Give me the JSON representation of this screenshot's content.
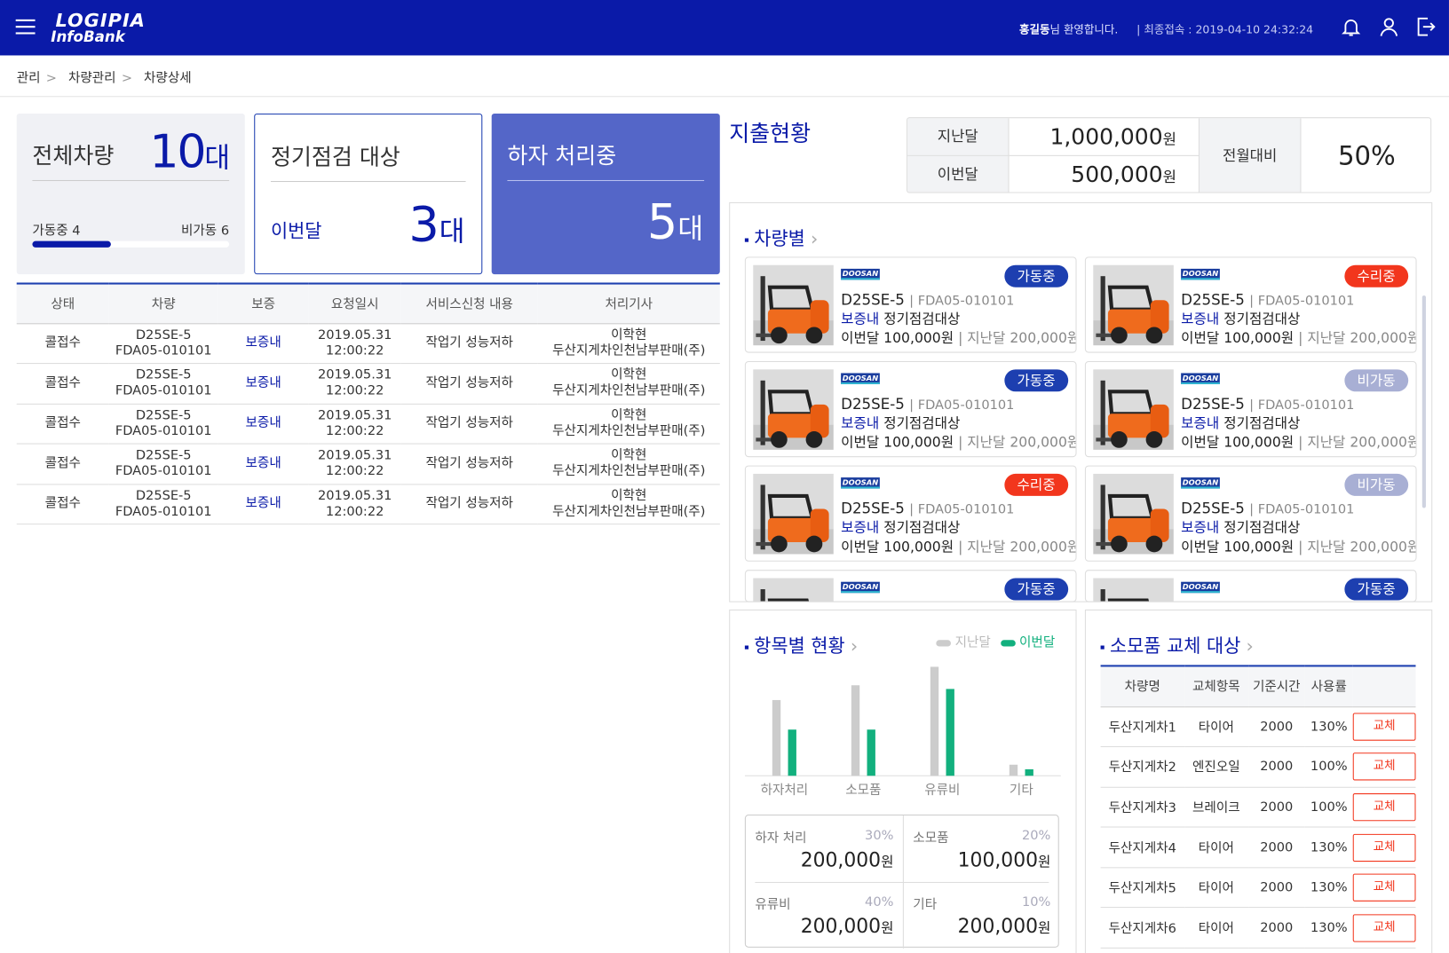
{
  "header": {
    "logo_top": "LOGIPIA",
    "logo_bottom": "InfoBank",
    "user_name": "홍길동",
    "welcome_suffix": "님 환영합니다.",
    "last_login": "|   최종접속 : 2019-04-10 24:32:24"
  },
  "breadcrumb": [
    "관리",
    "차량관리",
    "차량상세"
  ],
  "summary": {
    "total": {
      "title": "전체차량",
      "count": "10",
      "unit": "대",
      "active_label": "가동중 4",
      "inactive_label": "비가동 6",
      "active_ratio": 0.4
    },
    "inspect": {
      "title": "정기점검 대상",
      "period": "이번달",
      "count": "3",
      "unit": "대"
    },
    "defect": {
      "title": "하자 처리중",
      "count": "5",
      "unit": "대"
    }
  },
  "requests": {
    "columns": [
      "상태",
      "차량",
      "보증",
      "요청일시",
      "서비스신청 내용",
      "처리기사"
    ],
    "rows": [
      {
        "status": "콜접수",
        "model": "D25SE-5",
        "serial": "FDA05-010101",
        "warranty": "보증내",
        "date": "2019.05.31",
        "time": "12:00:22",
        "content": "작업기 성능저하",
        "tech": "이학현",
        "dealer": "두산지게차인천남부판매(주)"
      },
      {
        "status": "콜접수",
        "model": "D25SE-5",
        "serial": "FDA05-010101",
        "warranty": "보증내",
        "date": "2019.05.31",
        "time": "12:00:22",
        "content": "작업기 성능저하",
        "tech": "이학현",
        "dealer": "두산지게차인천남부판매(주)"
      },
      {
        "status": "콜접수",
        "model": "D25SE-5",
        "serial": "FDA05-010101",
        "warranty": "보증내",
        "date": "2019.05.31",
        "time": "12:00:22",
        "content": "작업기 성능저하",
        "tech": "이학현",
        "dealer": "두산지게차인천남부판매(주)"
      },
      {
        "status": "콜접수",
        "model": "D25SE-5",
        "serial": "FDA05-010101",
        "warranty": "보증내",
        "date": "2019.05.31",
        "time": "12:00:22",
        "content": "작업기 성능저하",
        "tech": "이학현",
        "dealer": "두산지게차인천남부판매(주)"
      },
      {
        "status": "콜접수",
        "model": "D25SE-5",
        "serial": "FDA05-010101",
        "warranty": "보증내",
        "date": "2019.05.31",
        "time": "12:00:22",
        "content": "작업기 성능저하",
        "tech": "이학현",
        "dealer": "두산지게차인천남부판매(주)"
      }
    ]
  },
  "expense": {
    "title": "지출현황",
    "last_label": "지난달",
    "last_value": "1,000,000",
    "this_label": "이번달",
    "this_value": "500,000",
    "currency": "원",
    "compare_label": "전월대비",
    "compare_value": "50%"
  },
  "vehicles": {
    "title": "차량별",
    "brand": "DOOSAN",
    "cards": [
      {
        "status": "가동중",
        "status_type": "on",
        "model": "D25SE-5",
        "serial": "FDA05-010101",
        "warranty": "보증내",
        "note": "정기점검대상",
        "this_month": "이번달 100,000원",
        "last_month": "지난달 200,000원"
      },
      {
        "status": "수리중",
        "status_type": "fix",
        "model": "D25SE-5",
        "serial": "FDA05-010101",
        "warranty": "보증내",
        "note": "정기점검대상",
        "this_month": "이번달 100,000원",
        "last_month": "지난달 200,000원"
      },
      {
        "status": "가동중",
        "status_type": "on",
        "model": "D25SE-5",
        "serial": "FDA05-010101",
        "warranty": "보증내",
        "note": "정기점검대상",
        "this_month": "이번달 100,000원",
        "last_month": "지난달 200,000원"
      },
      {
        "status": "비가동",
        "status_type": "off",
        "model": "D25SE-5",
        "serial": "FDA05-010101",
        "warranty": "보증내",
        "note": "정기점검대상",
        "this_month": "이번달 100,000원",
        "last_month": "지난달 200,000원"
      },
      {
        "status": "수리중",
        "status_type": "fix",
        "model": "D25SE-5",
        "serial": "FDA05-010101",
        "warranty": "보증내",
        "note": "정기점검대상",
        "this_month": "이번달 100,000원",
        "last_month": "지난달 200,000원"
      },
      {
        "status": "비가동",
        "status_type": "off",
        "model": "D25SE-5",
        "serial": "FDA05-010101",
        "warranty": "보증내",
        "note": "정기점검대상",
        "this_month": "이번달 100,000원",
        "last_month": "지난달 200,000원"
      },
      {
        "status": "가동중",
        "status_type": "on",
        "model": "",
        "serial": "",
        "warranty": "",
        "note": "",
        "this_month": "",
        "last_month": ""
      },
      {
        "status": "가동중",
        "status_type": "on",
        "model": "",
        "serial": "",
        "warranty": "",
        "note": "",
        "this_month": "",
        "last_month": ""
      }
    ]
  },
  "items": {
    "title": "항목별 현황",
    "legend_last": "지난달",
    "legend_this": "이번달",
    "colors": {
      "last": "#cccccc",
      "this": "#12b07e"
    },
    "summary": [
      {
        "label": "하자 처리",
        "percent": "30%",
        "value": "200,000",
        "unit": "원"
      },
      {
        "label": "소모품",
        "percent": "20%",
        "value": "100,000",
        "unit": "원"
      },
      {
        "label": "유류비",
        "percent": "40%",
        "value": "200,000",
        "unit": "원"
      },
      {
        "label": "기타",
        "percent": "10%",
        "value": "200,000",
        "unit": "원"
      }
    ]
  },
  "chart_data": {
    "type": "bar",
    "categories": [
      "하자처리",
      "소모품",
      "유류비",
      "기타"
    ],
    "series": [
      {
        "name": "지난달",
        "values": [
          82,
          98,
          118,
          12
        ]
      },
      {
        "name": "이번달",
        "values": [
          50,
          50,
          94,
          7
        ]
      }
    ],
    "ylim": [
      0,
      125
    ],
    "grid": false,
    "legend": "top-right"
  },
  "parts": {
    "title": "소모품 교체 대상",
    "columns": [
      "차량명",
      "교체항목",
      "기준시간",
      "사용률"
    ],
    "button_label": "교체",
    "rows": [
      {
        "name": "두산지게차1",
        "item": "타이어",
        "hours": "2000",
        "usage": "130%"
      },
      {
        "name": "두산지게차2",
        "item": "엔진오일",
        "hours": "2000",
        "usage": "100%"
      },
      {
        "name": "두산지게차3",
        "item": "브레이크",
        "hours": "2000",
        "usage": "100%"
      },
      {
        "name": "두산지게차4",
        "item": "타이어",
        "hours": "2000",
        "usage": "130%"
      },
      {
        "name": "두산지게차5",
        "item": "타이어",
        "hours": "2000",
        "usage": "130%"
      },
      {
        "name": "두산지게차6",
        "item": "타이어",
        "hours": "2000",
        "usage": "130%"
      }
    ]
  }
}
